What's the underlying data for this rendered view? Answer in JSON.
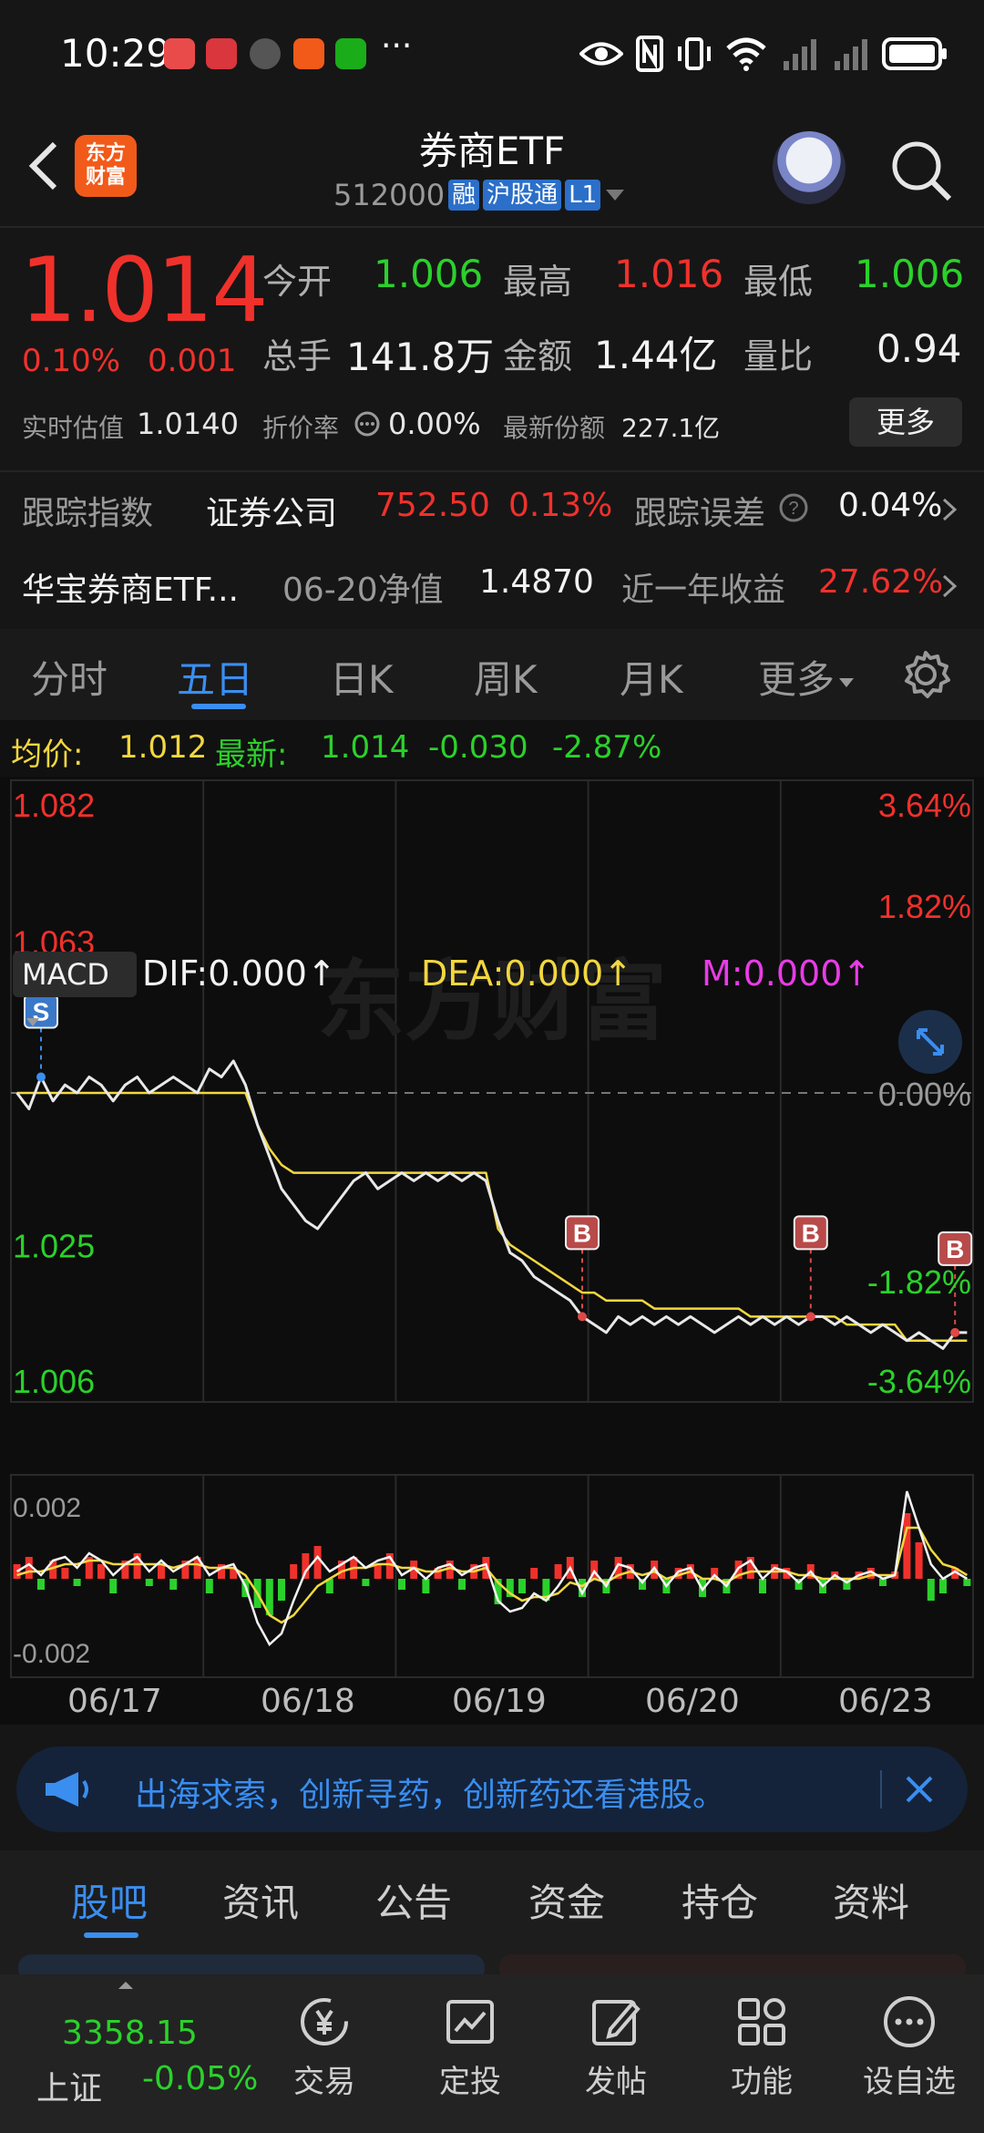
{
  "status_bar": {
    "time": "10:29",
    "more": "···"
  },
  "header": {
    "logo_text": "东方\n财富",
    "title": "券商ETF",
    "code": "512000",
    "tags": [
      "融",
      "沪股通",
      "L1"
    ]
  },
  "quote": {
    "price": "1.014",
    "change_pct": "0.10%",
    "change": "0.001",
    "open_label": "今开",
    "open": "1.006",
    "high_label": "最高",
    "high": "1.016",
    "low_label": "最低",
    "low": "1.006",
    "volume_label": "总手",
    "volume": "141.8万",
    "amount_label": "金额",
    "amount": "1.44亿",
    "ratio_label": "量比",
    "ratio": "0.94",
    "iopv_label": "实时估值",
    "iopv": "1.0140",
    "discount_label": "折价率",
    "discount": "0.00%",
    "shares_label": "最新份额",
    "shares": "227.1亿",
    "more_button": "更多"
  },
  "tracking": {
    "index_label": "跟踪指数",
    "index_name": "证券公司",
    "index_value": "752.50",
    "index_pct": "0.13%",
    "error_label": "跟踪误差",
    "error_value": "0.04%",
    "fund_name": "华宝券商ETF...",
    "nav_label": "06-20净值",
    "nav_value": "1.4870",
    "year_label": "近一年收益",
    "year_value": "27.62%"
  },
  "chart_tabs": [
    "分时",
    "五日",
    "日K",
    "周K",
    "月K",
    "更多"
  ],
  "active_chart_tab": "五日",
  "avg_line": {
    "avg_label": "均价:",
    "avg_value": "1.012",
    "latest_label": "最新:",
    "latest_value": "1.014",
    "latest_change": "-0.030",
    "latest_pct": "-2.87%"
  },
  "chart_data": {
    "type": "line",
    "watermark": "东方财富",
    "y_left_ticks": [
      "1.082",
      "1.063",
      "1.025",
      "1.006"
    ],
    "y_right_ticks": [
      "3.64%",
      "1.82%",
      "0.00%",
      "-1.82%",
      "-3.64%"
    ],
    "ylim": [
      1.006,
      1.082
    ],
    "baseline": 1.044,
    "x_labels": [
      "06/17",
      "06/18",
      "06/19",
      "06/20",
      "06/23"
    ],
    "series": [
      {
        "values": [
          1.044,
          1.042,
          1.046,
          1.043,
          1.045,
          1.044,
          1.046,
          1.045,
          1.043,
          1.045,
          1.046,
          1.044,
          1.045,
          1.046,
          1.045,
          1.044,
          1.047,
          1.046,
          1.048,
          1.045,
          1.04,
          1.036,
          1.032,
          1.03,
          1.028,
          1.027,
          1.029,
          1.031,
          1.033,
          1.034,
          1.032,
          1.033,
          1.034,
          1.033,
          1.034,
          1.033,
          1.034,
          1.033,
          1.034,
          1.033,
          1.028,
          1.024,
          1.023,
          1.021,
          1.02,
          1.019,
          1.018,
          1.016,
          1.015,
          1.014,
          1.016,
          1.015,
          1.016,
          1.015,
          1.016,
          1.015,
          1.016,
          1.015,
          1.014,
          1.015,
          1.016,
          1.015,
          1.016,
          1.015,
          1.016,
          1.015,
          1.016,
          1.016,
          1.015,
          1.016,
          1.015,
          1.014,
          1.015,
          1.014,
          1.013,
          1.014,
          1.013,
          1.012,
          1.014,
          1.014
        ]
      },
      {
        "values": [
          1.044,
          1.044,
          1.044,
          1.044,
          1.044,
          1.044,
          1.044,
          1.044,
          1.044,
          1.044,
          1.044,
          1.044,
          1.044,
          1.044,
          1.044,
          1.044,
          1.044,
          1.044,
          1.044,
          1.044,
          1.04,
          1.037,
          1.035,
          1.034,
          1.034,
          1.034,
          1.034,
          1.034,
          1.034,
          1.034,
          1.034,
          1.034,
          1.034,
          1.034,
          1.034,
          1.034,
          1.034,
          1.034,
          1.034,
          1.034,
          1.027,
          1.025,
          1.024,
          1.023,
          1.022,
          1.021,
          1.02,
          1.019,
          1.019,
          1.018,
          1.018,
          1.018,
          1.018,
          1.017,
          1.017,
          1.017,
          1.017,
          1.017,
          1.017,
          1.017,
          1.017,
          1.016,
          1.016,
          1.016,
          1.016,
          1.016,
          1.016,
          1.016,
          1.016,
          1.015,
          1.015,
          1.015,
          1.015,
          1.015,
          1.013,
          1.013,
          1.013,
          1.013,
          1.013,
          1.013
        ]
      }
    ],
    "markers": [
      {
        "label": "S",
        "index": 2
      },
      {
        "label": "B",
        "index": 47
      },
      {
        "label": "B",
        "index": 66
      },
      {
        "label": "B",
        "index": 78
      }
    ]
  },
  "macd": {
    "name": "MACD",
    "dif_label": "DIF:",
    "dif": "0.000",
    "dea_label": "DEA:",
    "dea": "0.000",
    "m_label": "M:",
    "m": "0.000",
    "arrow": "↑",
    "y_ticks": [
      "0.002",
      "-0.002"
    ],
    "ylim": [
      -0.0025,
      0.0025
    ],
    "bars": [
      0.0004,
      0.0006,
      -0.0003,
      0.0005,
      0.0003,
      -0.0002,
      0.0006,
      0.0004,
      -0.0004,
      0.0005,
      0.0007,
      -0.0002,
      0.0004,
      -0.0003,
      0.0005,
      0.0006,
      -0.0004,
      0.0004,
      0.0003,
      -0.0005,
      -0.0008,
      -0.001,
      -0.0006,
      0.0004,
      0.0007,
      0.0009,
      -0.0004,
      0.0005,
      0.0006,
      -0.0002,
      0.0004,
      0.0007,
      -0.0003,
      0.0005,
      -0.0004,
      0.0003,
      0.0005,
      -0.0003,
      0.0004,
      0.0006,
      -0.0007,
      -0.0005,
      -0.0004,
      0.0003,
      -0.0006,
      0.0004,
      0.0006,
      -0.0005,
      0.0005,
      -0.0004,
      0.0006,
      0.0004,
      -0.0003,
      0.0005,
      -0.0004,
      0.0003,
      0.0004,
      -0.0005,
      0.0003,
      -0.0004,
      0.0005,
      0.0006,
      -0.0004,
      0.0004,
      0.0003,
      -0.0003,
      0.0004,
      -0.0004,
      0.0002,
      -0.0003,
      0.0002,
      0.0003,
      -0.0002,
      0.0002,
      0.0018,
      0.001,
      -0.0006,
      -0.0004,
      0.0003,
      -0.0002
    ],
    "dif_values": [
      0.0002,
      0.0004,
      0.0001,
      0.0005,
      0.0006,
      0.0003,
      0.0007,
      0.0005,
      0.0001,
      0.0004,
      0.0006,
      0.0002,
      0.0005,
      0.0002,
      0.0004,
      0.0006,
      0.0001,
      0.0003,
      0.0004,
      -0.0002,
      -0.0012,
      -0.0018,
      -0.0015,
      -0.0006,
      0.0002,
      0.0006,
      0.0002,
      0.0004,
      0.0006,
      0.0003,
      0.0005,
      0.0006,
      0.0001,
      0.0003,
      0.0,
      0.0003,
      0.0004,
      0.0001,
      0.0003,
      0.0004,
      -0.0006,
      -0.0009,
      -0.0008,
      -0.0004,
      -0.0006,
      -0.0002,
      0.0003,
      -0.0004,
      0.0002,
      -0.0002,
      0.0004,
      0.0003,
      -0.0001,
      0.0003,
      -0.0002,
      0.0002,
      0.0003,
      -0.0003,
      0.0001,
      -0.0002,
      0.0003,
      0.0005,
      0.0,
      0.0003,
      0.0002,
      -0.0001,
      0.0002,
      -0.0002,
      0.0001,
      -0.0001,
      0.0001,
      0.0002,
      0.0,
      0.0001,
      0.0024,
      0.0014,
      0.0004,
      0.0,
      0.0002,
      0.0
    ],
    "dea_values": [
      0.0001,
      0.0002,
      0.0002,
      0.0003,
      0.0004,
      0.0004,
      0.0005,
      0.0005,
      0.0004,
      0.0004,
      0.0004,
      0.0004,
      0.0004,
      0.0003,
      0.0004,
      0.0004,
      0.0003,
      0.0003,
      0.0003,
      0.0001,
      -0.0004,
      -0.001,
      -0.0012,
      -0.001,
      -0.0006,
      -0.0002,
      0.0,
      0.0002,
      0.0003,
      0.0003,
      0.0004,
      0.0004,
      0.0003,
      0.0003,
      0.0002,
      0.0002,
      0.0003,
      0.0002,
      0.0002,
      0.0003,
      -0.0001,
      -0.0004,
      -0.0006,
      -0.0005,
      -0.0005,
      -0.0004,
      -0.0001,
      -0.0002,
      0.0,
      -0.0001,
      0.0001,
      0.0002,
      0.0001,
      0.0002,
      0.0,
      0.0001,
      0.0002,
      0.0,
      0.0,
      -0.0001,
      0.0001,
      0.0002,
      0.0002,
      0.0002,
      0.0002,
      0.0001,
      0.0001,
      0.0,
      0.0,
      0.0,
      0.0,
      0.0001,
      0.0001,
      0.0001,
      0.0014,
      0.0014,
      0.0008,
      0.0004,
      0.0003,
      0.0001
    ]
  },
  "banner": {
    "text": "出海求索，创新寻药，创新药还看港股。"
  },
  "bottom_tabs": [
    "股吧",
    "资讯",
    "公告",
    "资金",
    "持仓",
    "资料"
  ],
  "active_bottom_tab": "股吧",
  "bottom_nav": {
    "index_value": "3358.15",
    "index_name": "上证",
    "index_pct": "-0.05%",
    "items": [
      "交易",
      "定投",
      "发帖",
      "功能",
      "设自选"
    ]
  },
  "colors": {
    "up": "#f0312b",
    "down": "#2bd12b",
    "accent": "#3a8ef0",
    "avg_line": "#f2d740"
  }
}
